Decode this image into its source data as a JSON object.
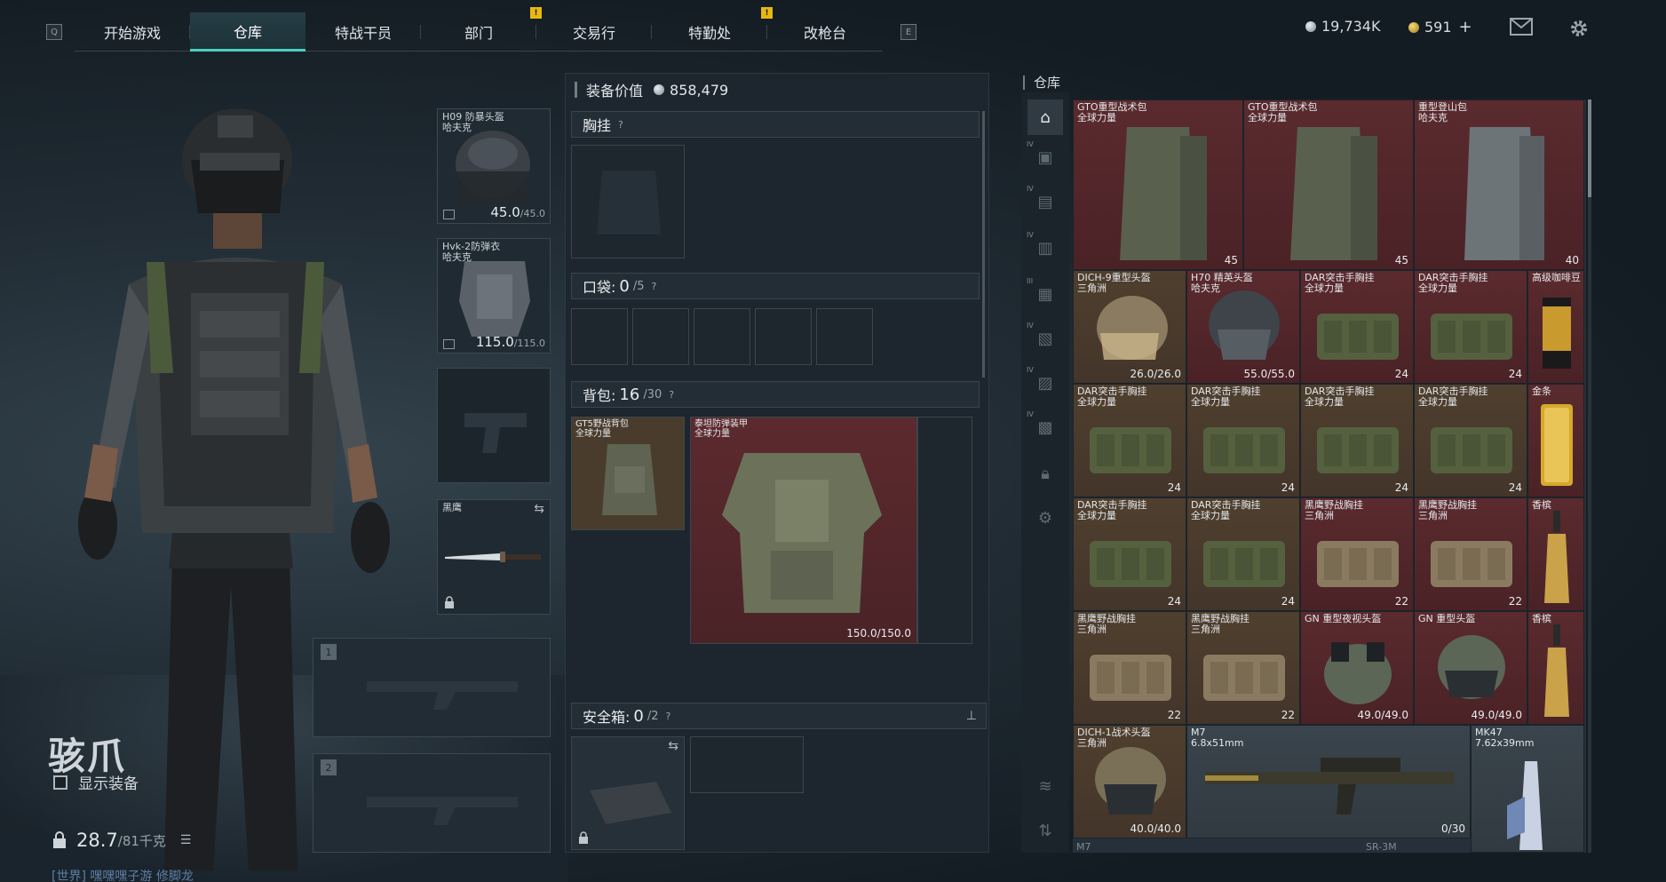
{
  "nav": {
    "q_key": "Q",
    "e_key": "E",
    "tabs": [
      {
        "label": "开始游戏"
      },
      {
        "label": "仓库"
      },
      {
        "label": "特战干员"
      },
      {
        "label": "部门",
        "alert": "!"
      },
      {
        "label": "交易行"
      },
      {
        "label": "特勤处",
        "alert": "!"
      },
      {
        "label": "改枪台"
      }
    ],
    "active_tab": "仓库"
  },
  "currency": {
    "silver": "19,734K",
    "gold": "591",
    "gold_add": "+"
  },
  "character": {
    "name": "骇爪",
    "show_gear_label": "显示装备",
    "weight_value": "28.7",
    "weight_max": "/81千克",
    "chat_text": "[世界] 嘿嘿嘿子游 修脚龙"
  },
  "slots": {
    "helmet": {
      "name": "H09 防暴头盔",
      "sub": "哈夫克",
      "durability": "45.0",
      "max": "/45.0"
    },
    "armor": {
      "name": "Hvk-2防弹衣",
      "sub": "哈夫克",
      "durability": "115.0",
      "max": "/115.0"
    },
    "melee": {
      "name": "黑鹰"
    },
    "weapon1_tag": "1",
    "weapon2_tag": "2"
  },
  "loadout": {
    "value_label": "装备价值",
    "value": "858,479",
    "chest_label": "胸挂",
    "pocket_label": "口袋:",
    "pocket_used": "0",
    "pocket_max": "/5",
    "backpack_label": "背包:",
    "backpack_used": "16",
    "backpack_max": "/30",
    "backpack_items": [
      {
        "name": "GT5野战背包",
        "sub": "全球力量"
      },
      {
        "name": "泰坦防弹装甲",
        "sub": "全球力量",
        "durability": "150.0/150.0"
      }
    ],
    "safebox_label": "安全箱:",
    "safebox_used": "0",
    "safebox_max": "/2",
    "help": "?"
  },
  "storage": {
    "title": "仓库",
    "items": [
      {
        "name": "GTO重型战术包",
        "sub": "全球力量",
        "count": "45"
      },
      {
        "name": "GTO重型战术包",
        "sub": "全球力量",
        "count": "45"
      },
      {
        "name": "重型登山包",
        "sub": "哈夫克",
        "count": "40"
      },
      {
        "name": "DICH-9重型头盔",
        "sub": "三角洲",
        "count": "26.0/26.0"
      },
      {
        "name": "H70 精英头盔",
        "sub": "哈夫克",
        "count": "55.0/55.0"
      },
      {
        "name": "DAR突击手胸挂",
        "sub": "全球力量",
        "count": "24"
      },
      {
        "name": "DAR突击手胸挂",
        "sub": "全球力量",
        "count": "24"
      },
      {
        "name": "高级咖啡豆",
        "sub": "",
        "count": ""
      },
      {
        "name": "DAR突击手胸挂",
        "sub": "全球力量",
        "count": "24"
      },
      {
        "name": "DAR突击手胸挂",
        "sub": "全球力量",
        "count": "24"
      },
      {
        "name": "DAR突击手胸挂",
        "sub": "全球力量",
        "count": "24"
      },
      {
        "name": "DAR突击手胸挂",
        "sub": "全球力量",
        "count": "24"
      },
      {
        "name": "金条",
        "sub": "",
        "count": ""
      },
      {
        "name": "DAR突击手胸挂",
        "sub": "全球力量",
        "count": "24"
      },
      {
        "name": "DAR突击手胸挂",
        "sub": "全球力量",
        "count": "24"
      },
      {
        "name": "黑鹰野战胸挂",
        "sub": "三角洲",
        "count": "22"
      },
      {
        "name": "黑鹰野战胸挂",
        "sub": "三角洲",
        "count": "22"
      },
      {
        "name": "香槟",
        "sub": "",
        "count": ""
      },
      {
        "name": "黑鹰野战胸挂",
        "sub": "三角洲",
        "count": "22"
      },
      {
        "name": "黑鹰野战胸挂",
        "sub": "三角洲",
        "count": "22"
      },
      {
        "name": "GN 重型夜视头盔",
        "sub": "",
        "count": "49.0/49.0"
      },
      {
        "name": "GN 重型头盔",
        "sub": "",
        "count": "49.0/49.0"
      },
      {
        "name": "香槟",
        "sub": "",
        "count": ""
      },
      {
        "name": "DICH-1战术头盔",
        "sub": "三角洲",
        "count": "40.0/40.0"
      },
      {
        "name": "M7",
        "sub": "6.8x51mm",
        "count": "0/30"
      },
      {
        "name": "MK47",
        "sub": "7.62x39mm",
        "count": ""
      }
    ],
    "bottom_labels": [
      "M7",
      "SR-3M"
    ]
  },
  "colors": {
    "accent": "#4dd0bd",
    "alert": "#e8b80f",
    "rarity_red": "#5a2a2e",
    "rarity_gold": "#4f3f2e"
  }
}
